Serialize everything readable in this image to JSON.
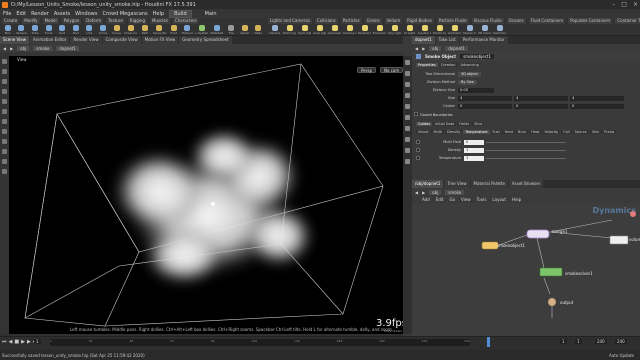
{
  "window": {
    "title": "D:/My/Lesson_Units_Smoke/lesson_unity_smoke.hip - Houdini FX 17.5.391"
  },
  "menubar": {
    "items": [
      "File",
      "Edit",
      "Render",
      "Assets",
      "Windows",
      "Crowd Megascans",
      "Help"
    ],
    "build": "Build",
    "desktop": "Main"
  },
  "shelf": {
    "tabs_left": [
      "Create",
      "Modify",
      "Model",
      "Polygon",
      "Deform",
      "Texture",
      "Rigging",
      "Muscles",
      "Characters",
      "Constraints",
      "Hair Utils",
      "Guide Process",
      "Guide Brushes"
    ],
    "tabs_right": [
      "Lights and Cameras",
      "Collisions",
      "Particles",
      "Grains",
      "Vellum",
      "Rigid Bodies",
      "Particle Fluids",
      "Viscous Fluids",
      "Oceans",
      "Fluid Containers",
      "Populate Containers",
      "Container Tools",
      "Pyro FX",
      "FEM"
    ],
    "tools_left": [
      {
        "label": "Box",
        "color": "#7aa6d8"
      },
      {
        "label": "Sphere",
        "color": "#7aa6d8"
      },
      {
        "label": "Tube",
        "color": "#7aa6d8"
      },
      {
        "label": "Torus",
        "color": "#7aa6d8"
      },
      {
        "label": "Grid",
        "color": "#7aa6d8"
      },
      {
        "label": "Null",
        "color": "#7aa6d8"
      },
      {
        "label": "Line",
        "color": "#7aa6d8"
      },
      {
        "label": "Circle",
        "color": "#7aa6d8"
      },
      {
        "label": "Curve",
        "color": "#d6b45a"
      },
      {
        "label": "Draw Curve",
        "color": "#d6b45a"
      },
      {
        "label": "Path",
        "color": "#d6b45a"
      },
      {
        "label": "Spray Paint",
        "color": "#d6b45a"
      },
      {
        "label": "Font",
        "color": "#d6b45a"
      },
      {
        "label": "Platonic",
        "color": "#7aa6d8"
      },
      {
        "label": "L-System",
        "color": "#8ec96f"
      },
      {
        "label": "Metaball",
        "color": "#7aa6d8"
      },
      {
        "label": "File",
        "color": "#9a9a9a"
      },
      {
        "label": "Spiral",
        "color": "#d6b45a"
      },
      {
        "label": "Helix",
        "color": "#d6b45a"
      }
    ],
    "tools_right": [
      {
        "label": "Camera",
        "color": "#9ab4d6"
      },
      {
        "label": "Point Light",
        "color": "#e8d36e"
      },
      {
        "label": "Spot Light",
        "color": "#e8d36e"
      },
      {
        "label": "Area Light",
        "color": "#e8d36e"
      },
      {
        "label": "Geometry Light",
        "color": "#e8d36e"
      },
      {
        "label": "Volume Light",
        "color": "#e8d36e"
      },
      {
        "label": "Distant Light",
        "color": "#e8d36e"
      },
      {
        "label": "Environment Light",
        "color": "#e8d36e"
      },
      {
        "label": "Sky Light",
        "color": "#e8d36e"
      },
      {
        "label": "GI Light",
        "color": "#e8d36e"
      },
      {
        "label": "Caustic Light",
        "color": "#e8d36e"
      },
      {
        "label": "Portal Light",
        "color": "#e8d36e"
      },
      {
        "label": "Ambient Light",
        "color": "#e8d36e"
      },
      {
        "label": "Stereo Camera",
        "color": "#9ab4d6"
      },
      {
        "label": "VR Camera",
        "color": "#9ab4d6"
      },
      {
        "label": "Switcher",
        "color": "#9ab4d6"
      }
    ]
  },
  "left_pane": {
    "tabs": [
      "Scene View",
      "Animation Editor",
      "Render View",
      "Composite View",
      "Motion FX View",
      "Geometry Spreadsheet"
    ],
    "path": {
      "root": "obj",
      "node": "smoke",
      "tab_node": "dopnet1"
    },
    "view_label": "View",
    "persp": "Persp",
    "cam": "No cam",
    "fps": "3.9fps",
    "fps_count": "1521 drawn",
    "hint": "Left mouse tumbles. Middle pans. Right dollies. Ctrl+Alt+Left box dollies. Ctrl+Right zooms. Spacebar-Ctrl-Left tilts. Hold L for alternate tumble, dolly, and zoom."
  },
  "param_pane": {
    "tabs": [
      "dopnet1",
      "Take List",
      "Performance Monitor"
    ],
    "path": {
      "root": "obj",
      "node": "dopnet1"
    },
    "node_type": "Smoke Object",
    "node_name": "smokeobject1",
    "main_tabs": [
      "Properties",
      "Creation",
      "Advancing"
    ],
    "rows": [
      {
        "label": "Two Dimensional",
        "value": "3D object"
      },
      {
        "label": "Division Method",
        "value": "By Size"
      },
      {
        "label": "Division Size",
        "value": "0.05"
      },
      {
        "label": "Size",
        "values": [
          "4",
          "4",
          "4"
        ]
      },
      {
        "label": "Center",
        "values": [
          "0",
          "0",
          "0"
        ]
      }
    ],
    "closed_boundaries": "Closed Boundaries",
    "sub_tabs": [
      "Guides",
      "Initial Data",
      "Fields",
      "Slice"
    ],
    "field_tabs": [
      "Visual",
      "Multi",
      "Density",
      "Temperature",
      "Fuel",
      "Heat",
      "Burn",
      "Heat",
      "Velocity",
      "Coll",
      "Source",
      "Sink",
      "Pump"
    ],
    "field_rows": [
      {
        "label": "Multi Field",
        "value": "0"
      },
      {
        "label": "Density",
        "value": "1"
      },
      {
        "label": "Temperature",
        "value": "1"
      }
    ]
  },
  "network": {
    "tabs": [
      "/obj/dopnet1",
      "Tree View",
      "Material Palette",
      "Asset Browser"
    ],
    "path": {
      "root": "obj",
      "node": "smoke"
    },
    "menu": [
      "Add",
      "Edit",
      "Go",
      "View",
      "Tools",
      "Layout",
      "Help"
    ],
    "context_label": "Dynamics",
    "nodes": {
      "merge": "merge1",
      "smokeobject": "smokeobject1",
      "smokesolver": "smokesolver1",
      "output": "output",
      "volume": "volume"
    }
  },
  "timeline": {
    "start": "1",
    "current": "1",
    "end": "240",
    "end2": "240",
    "ticks": [
      "1",
      "24",
      "48",
      "72",
      "96",
      "120",
      "144",
      "168",
      "192",
      "216",
      "240"
    ]
  },
  "status": {
    "message": "Successfully saved lesson_unity_smoke.hip (Sat Apr 25 11:59:42 2020)",
    "auto_update": "Auto Update"
  }
}
